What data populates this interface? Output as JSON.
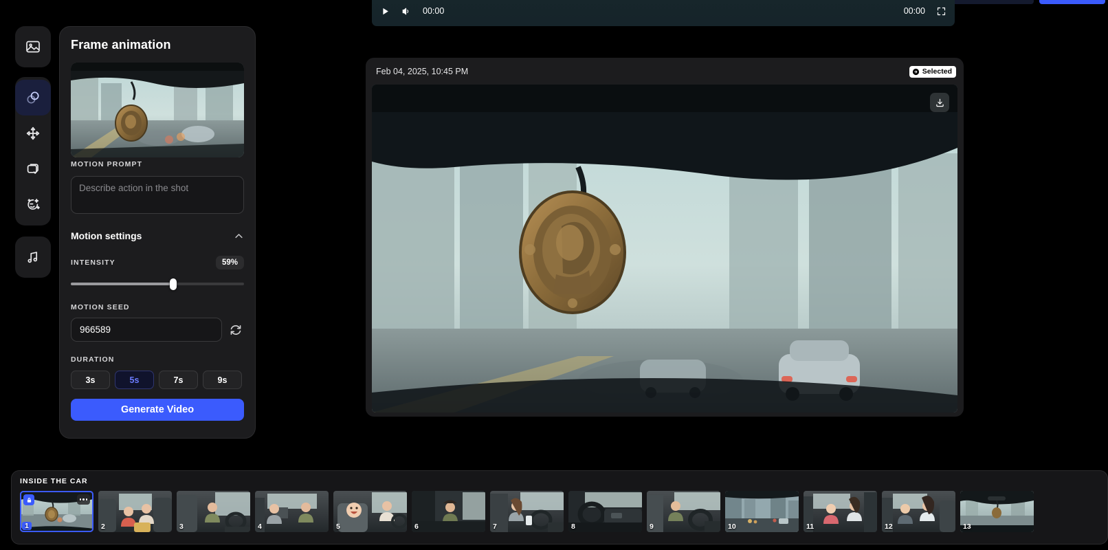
{
  "rail": {
    "groups": [
      {
        "items": [
          {
            "name": "image-icon",
            "label": "Images",
            "active": false
          }
        ]
      },
      {
        "items": [
          {
            "name": "frames-icon",
            "label": "Frame animation",
            "active": true
          },
          {
            "name": "transform-icon",
            "label": "Transform",
            "active": false
          },
          {
            "name": "layers-check-icon",
            "label": "Approved layers",
            "active": false
          },
          {
            "name": "face-sparkle-icon",
            "label": "Character",
            "active": false
          }
        ]
      },
      {
        "items": [
          {
            "name": "music-icon",
            "label": "Audio",
            "active": false
          }
        ]
      }
    ]
  },
  "panel": {
    "title": "Frame animation",
    "motion_prompt_label": "MOTION PROMPT",
    "motion_prompt_value": "",
    "motion_prompt_placeholder": "Describe action in the shot",
    "motion_settings_label": "Motion settings",
    "intensity_label": "INTENSITY",
    "intensity_value": "59%",
    "intensity_percent": 59,
    "seed_label": "MOTION SEED",
    "seed_value": "966589",
    "duration_label": "DURATION",
    "durations": [
      {
        "label": "3s",
        "selected": false
      },
      {
        "label": "5s",
        "selected": true
      },
      {
        "label": "7s",
        "selected": false
      },
      {
        "label": "9s",
        "selected": false
      }
    ],
    "generate_label": "Generate Video"
  },
  "player": {
    "current_time": "00:00",
    "total_time": "00:00"
  },
  "preview": {
    "date": "Feb 04, 2025, 10:45 PM",
    "selected_label": "Selected"
  },
  "filmstrip": {
    "label": "INSIDE THE CAR",
    "thumbs": [
      {
        "num": "1",
        "selected": true
      },
      {
        "num": "2",
        "selected": false
      },
      {
        "num": "3",
        "selected": false
      },
      {
        "num": "4",
        "selected": false
      },
      {
        "num": "5",
        "selected": false
      },
      {
        "num": "6",
        "selected": false
      },
      {
        "num": "7",
        "selected": false
      },
      {
        "num": "8",
        "selected": false
      },
      {
        "num": "9",
        "selected": false
      },
      {
        "num": "10",
        "selected": false
      },
      {
        "num": "11",
        "selected": false
      },
      {
        "num": "12",
        "selected": false
      },
      {
        "num": "13",
        "selected": false
      }
    ]
  },
  "colors": {
    "accent": "#3b5bfd",
    "panel_bg": "#1c1c1e",
    "page_bg": "#000000",
    "selected_badge_bg": "#ffffff"
  }
}
